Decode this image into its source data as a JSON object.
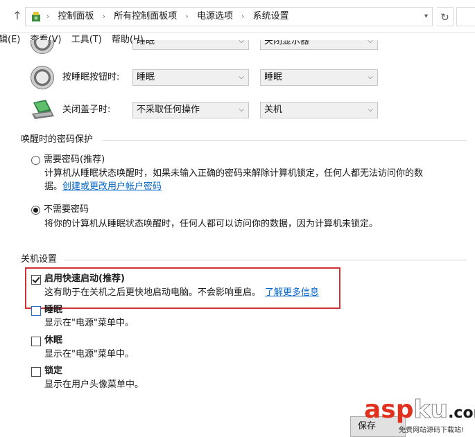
{
  "address": {
    "crumbs": [
      "控制面板",
      "所有控制面板项",
      "电源选项",
      "系统设置"
    ],
    "up_icon": "arrow-up-icon",
    "refresh_icon": "refresh-icon"
  },
  "menu": {
    "items": [
      "辑(E)",
      "查看(V)",
      "工具(T)",
      "帮助(H)"
    ]
  },
  "buttons_section": {
    "cut_row": {
      "value1": "睡眠",
      "value2": "关闭显示器"
    },
    "sleep_button": {
      "label": "按睡眠按钮时:",
      "on_battery": "睡眠",
      "plugged_in": "睡眠"
    },
    "lid_close": {
      "label": "关闭盖子时:",
      "on_battery": "不采取任何操作",
      "plugged_in": "关机"
    }
  },
  "password_section": {
    "title": "唤醒时的密码保护",
    "require": {
      "label": "需要密码(推荐)",
      "desc_line1": "计算机从睡眠状态唤醒时，如果未输入正确的密码来解除计算机锁定，任何人都无法访问你的数",
      "desc_line2_prefix": "据。",
      "link": "创建或更改用户帐户密码",
      "selected": false
    },
    "no_require": {
      "label": "不需要密码",
      "desc": "将你的计算机从睡眠状态唤醒时，任何人都可以访问你的数据，因为计算机未锁定。",
      "selected": true
    }
  },
  "shutdown_section": {
    "title": "关机设置",
    "fast_startup": {
      "label": "启用快速启动(推荐)",
      "desc": "这有助于在关机之后更快地启动电脑。不会影响重启。",
      "link": "了解更多信息",
      "checked": true
    },
    "sleep": {
      "label": "睡眠",
      "desc": "显示在\"电源\"菜单中。",
      "checked": false
    },
    "hibernate": {
      "label": "休眠",
      "desc": "显示在\"电源\"菜单中。",
      "checked": false
    },
    "lock": {
      "label": "锁定",
      "desc": "显示在用户头像菜单中。",
      "checked": false
    }
  },
  "footer": {
    "save_label": "保存"
  },
  "watermark": {
    "logo_a": "asp",
    "logo_b": "ku",
    "logo_c": ".com",
    "sub": "免费网站源码下载站!"
  },
  "colors": {
    "highlight_border": "#d03236",
    "link": "#0066cc",
    "accent_check": "#1f6fd1"
  }
}
